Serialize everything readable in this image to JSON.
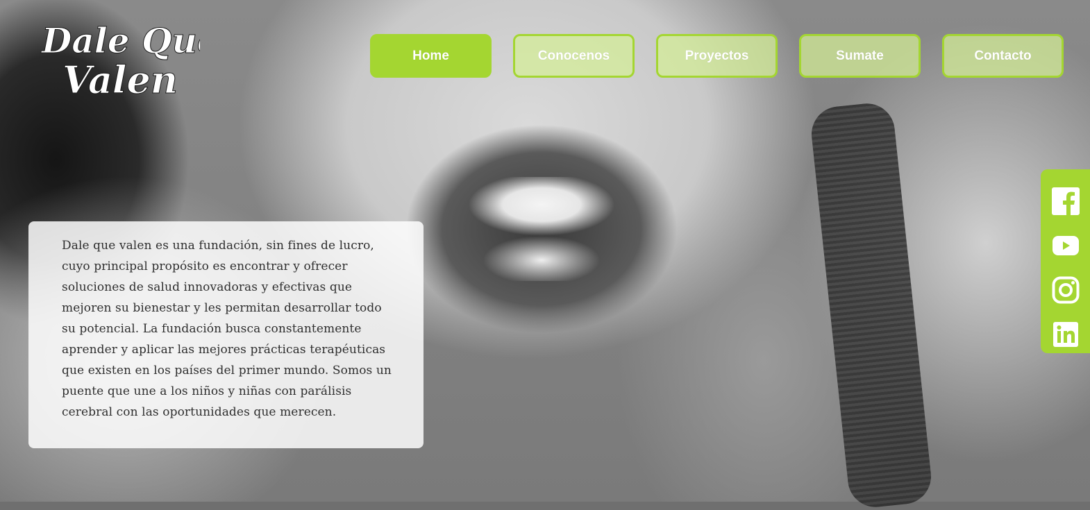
{
  "brand": {
    "logo_line1": "Dale Que",
    "logo_line2": "Valen",
    "accent_color": "#a4d631"
  },
  "nav": {
    "items": [
      {
        "label": "Home",
        "active": true
      },
      {
        "label": "Conocenos",
        "active": false
      },
      {
        "label": "Proyectos",
        "active": false
      },
      {
        "label": "Sumate",
        "active": false
      },
      {
        "label": "Contacto",
        "active": false
      }
    ]
  },
  "social": {
    "items": [
      {
        "icon": "facebook-icon"
      },
      {
        "icon": "youtube-icon"
      },
      {
        "icon": "instagram-icon"
      },
      {
        "icon": "linkedin-icon"
      }
    ]
  },
  "intro": {
    "text": "Dale que valen es una fundación, sin fines de lucro, cuyo principal propósito es encontrar y ofrecer soluciones de salud innovadoras y efectivas que mejoren su bienestar y les permitan desarrollar todo su potencial. La fundación busca constantemente aprender y aplicar las mejores prácticas terapéuticas que existen en los países del primer mundo. Somos un puente que une a los niños y niñas con parálisis cerebral con las oportunidades que merecen."
  }
}
